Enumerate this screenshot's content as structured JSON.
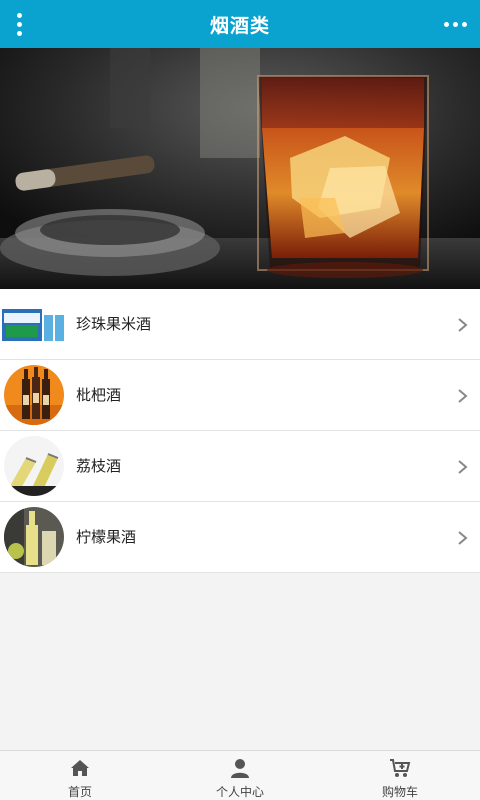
{
  "header": {
    "title": "烟酒类"
  },
  "items": [
    {
      "label": "珍珠果米酒"
    },
    {
      "label": "枇杷酒"
    },
    {
      "label": "荔枝酒"
    },
    {
      "label": "柠檬果酒"
    }
  ],
  "tabbar": {
    "home": "首页",
    "profile": "个人中心",
    "cart": "购物车"
  },
  "colors": {
    "header_bg": "#0aa3cf",
    "page_bg": "#f3f3f3"
  }
}
